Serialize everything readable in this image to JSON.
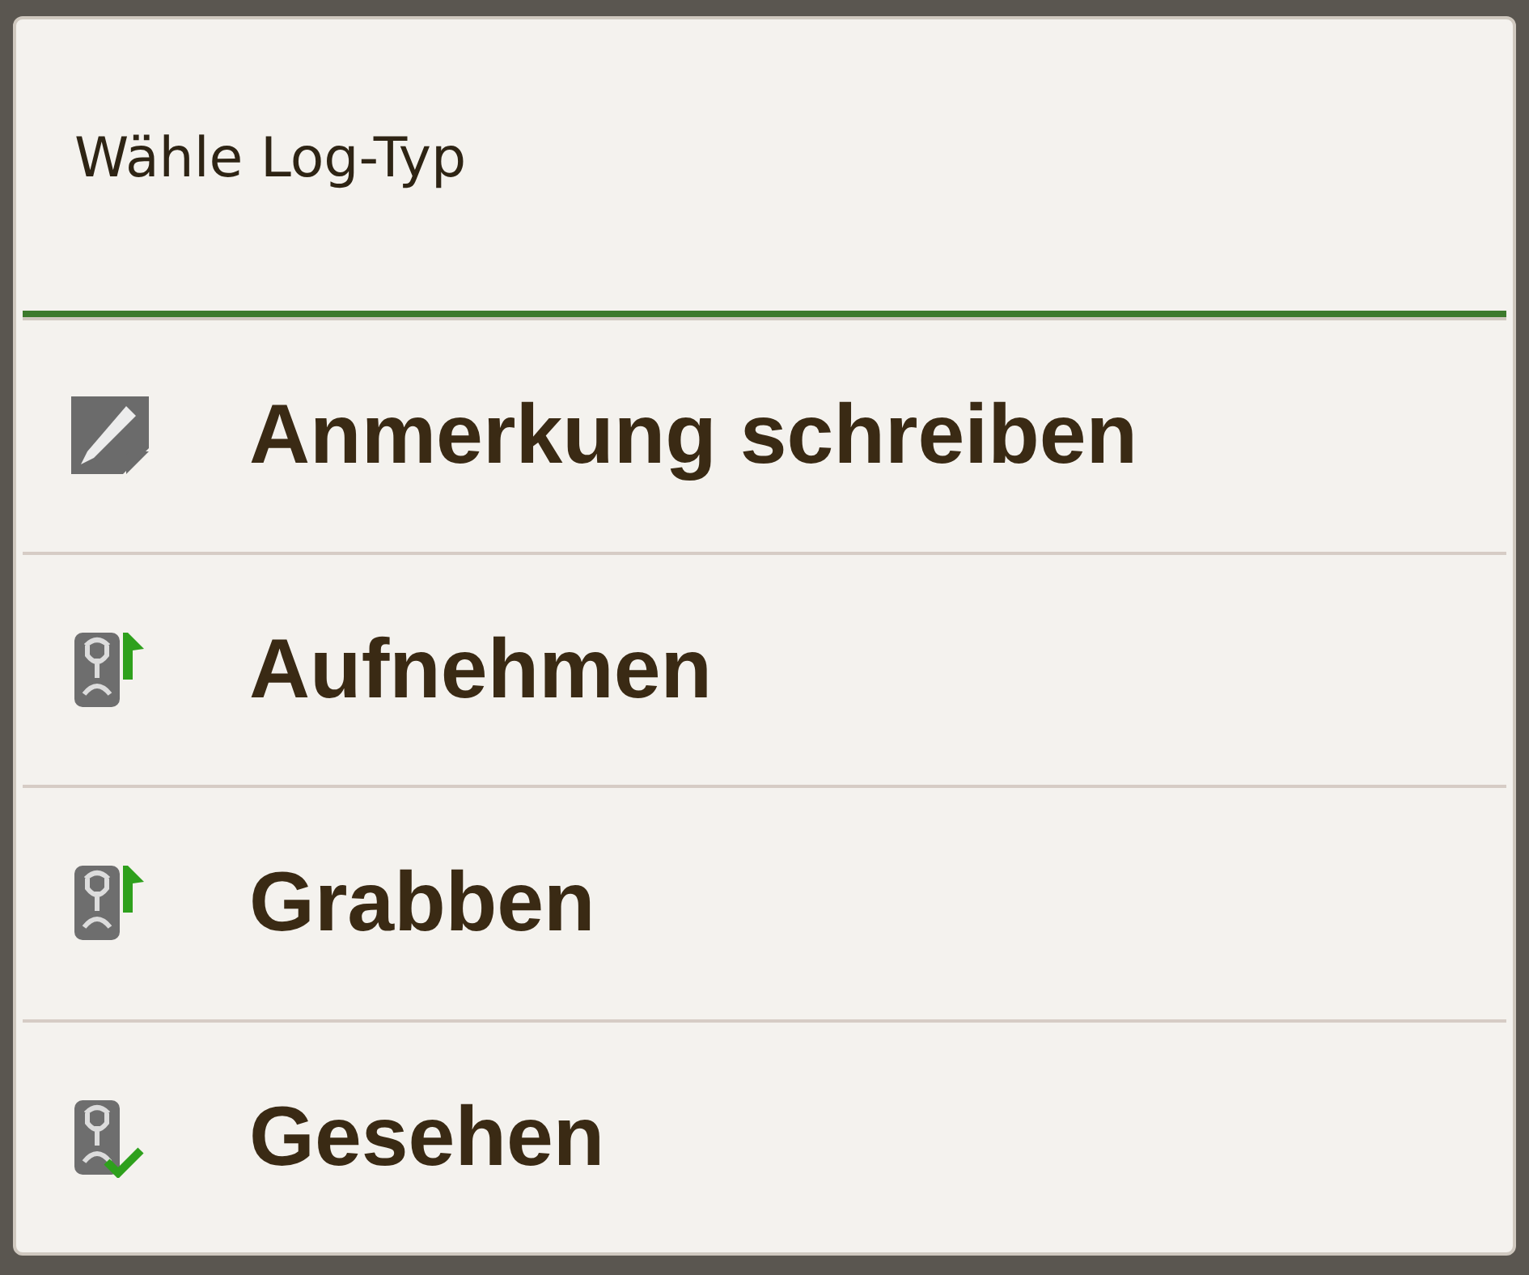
{
  "dialog": {
    "title": "Wähle Log-Typ",
    "items": [
      {
        "label": "Anmerkung schreiben",
        "kind": "note"
      },
      {
        "label": "Aufnehmen",
        "kind": "pickup"
      },
      {
        "label": "Grabben",
        "kind": "pickup"
      },
      {
        "label": "Gesehen",
        "kind": "seen"
      }
    ]
  }
}
